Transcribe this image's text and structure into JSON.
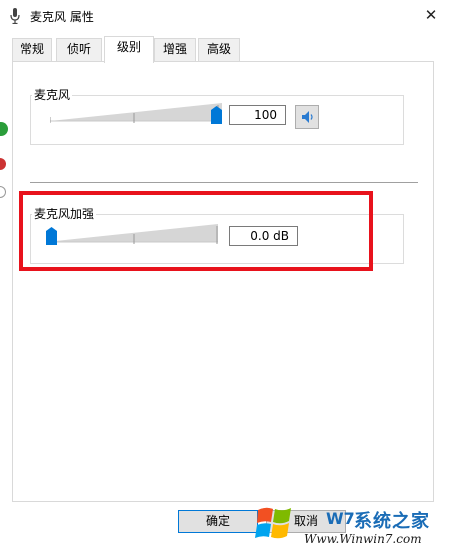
{
  "window": {
    "title": "麦克风 属性",
    "close_glyph": "✕"
  },
  "tabs": [
    {
      "label": "常规"
    },
    {
      "label": "侦听"
    },
    {
      "label": "级别"
    },
    {
      "label": "增强"
    },
    {
      "label": "高级"
    }
  ],
  "active_tab": "级别",
  "microphone": {
    "label": "麦克风",
    "value_text": "100",
    "level_fraction": 1.0,
    "speaker_icon": "speaker-icon"
  },
  "boost": {
    "label": "麦克风加强",
    "value_text": "0.0 dB",
    "level_fraction": 0.0
  },
  "buttons": {
    "ok": "确定",
    "cancel": "取消"
  },
  "watermark": {
    "brand": "系统之家",
    "url": "Www.Winwin7.com",
    "w7": "W7"
  },
  "colors": {
    "accent": "#0078d7",
    "highlight": "#e8121c"
  }
}
